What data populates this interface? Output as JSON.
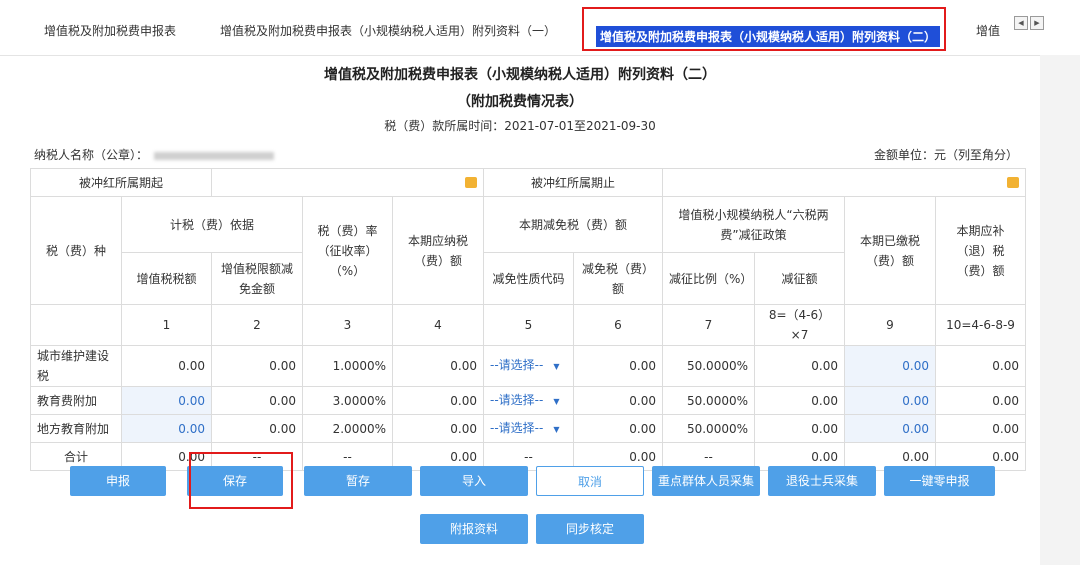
{
  "tabs": [
    "增值税及附加税费申报表",
    "增值税及附加税费申报表（小规模纳税人适用）附列资料（一）",
    "增值税及附加税费申报表（小规模纳税人适用）附列资料（二）",
    "增值"
  ],
  "nav": {
    "prev": "◀",
    "next": "▶"
  },
  "title1": "增值税及附加税费申报表（小规模纳税人适用）附列资料（二）",
  "title2": "（附加税费情况表）",
  "period": "税（费）款所属时间：2021-07-01至2021-09-30",
  "taxpayer_label": "纳税人名称（公章）：",
  "unit": "金额单位：元（列至角分）",
  "period_row": {
    "start_label": "被冲红所属期起",
    "end_label": "被冲红所属期止"
  },
  "headers": {
    "tax_type": "税（费）种",
    "basis": "计税（费）依据",
    "basis_vat": "增值税税额",
    "basis_deduct": "增值税限额减免金额",
    "rate": "税（费）率（征收率）（%）",
    "payable": "本期应纳税（费）额",
    "relief": "本期减免税（费）额",
    "relief_code": "减免性质代码",
    "relief_amount": "减免税（费）额",
    "policy": "增值税小规模纳税人“六税两费”减征政策",
    "policy_ratio": "减征比例（%）",
    "policy_amount": "减征额",
    "paid": "本期已缴税（费）额",
    "refund": "本期应补（退）税（费）额"
  },
  "col_numbers": [
    "1",
    "2",
    "3",
    "4",
    "5",
    "6",
    "7",
    "8=（4-6）×7",
    "9",
    "10=4-6-8-9"
  ],
  "rows": [
    {
      "name": "城市维护建设税",
      "c1": "0.00",
      "c2": "0.00",
      "c3": "1.0000%",
      "c4": "0.00",
      "c5": "--请选择--",
      "c6": "0.00",
      "c7": "50.0000%",
      "c8": "0.00",
      "c9": "0.00",
      "c10": "0.00"
    },
    {
      "name": "教育费附加",
      "c1": "0.00",
      "c2": "0.00",
      "c3": "3.0000%",
      "c4": "0.00",
      "c5": "--请选择--",
      "c6": "0.00",
      "c7": "50.0000%",
      "c8": "0.00",
      "c9": "0.00",
      "c10": "0.00"
    },
    {
      "name": "地方教育附加",
      "c1": "0.00",
      "c2": "0.00",
      "c3": "2.0000%",
      "c4": "0.00",
      "c5": "--请选择--",
      "c6": "0.00",
      "c7": "50.0000%",
      "c8": "0.00",
      "c9": "0.00",
      "c10": "0.00"
    }
  ],
  "total": {
    "name": "合计",
    "c1": "0.00",
    "c2": "--",
    "c3": "--",
    "c4": "0.00",
    "c5": "--",
    "c6": "0.00",
    "c7": "--",
    "c8": "0.00",
    "c9": "0.00",
    "c10": "0.00"
  },
  "buttons": {
    "declare": "申报",
    "save": "保存",
    "temp_save": "暂存",
    "import": "导入",
    "cancel": "取消",
    "key_group": "重点群体人员采集",
    "veteran": "退役士兵采集",
    "zero_declare": "一键零申报",
    "attach": "附报资料",
    "verify": "同步核定"
  },
  "colors": {
    "accent": "#4fa0e8",
    "highlight": "#e21b1b",
    "active_tab": "#1f4fd8"
  }
}
